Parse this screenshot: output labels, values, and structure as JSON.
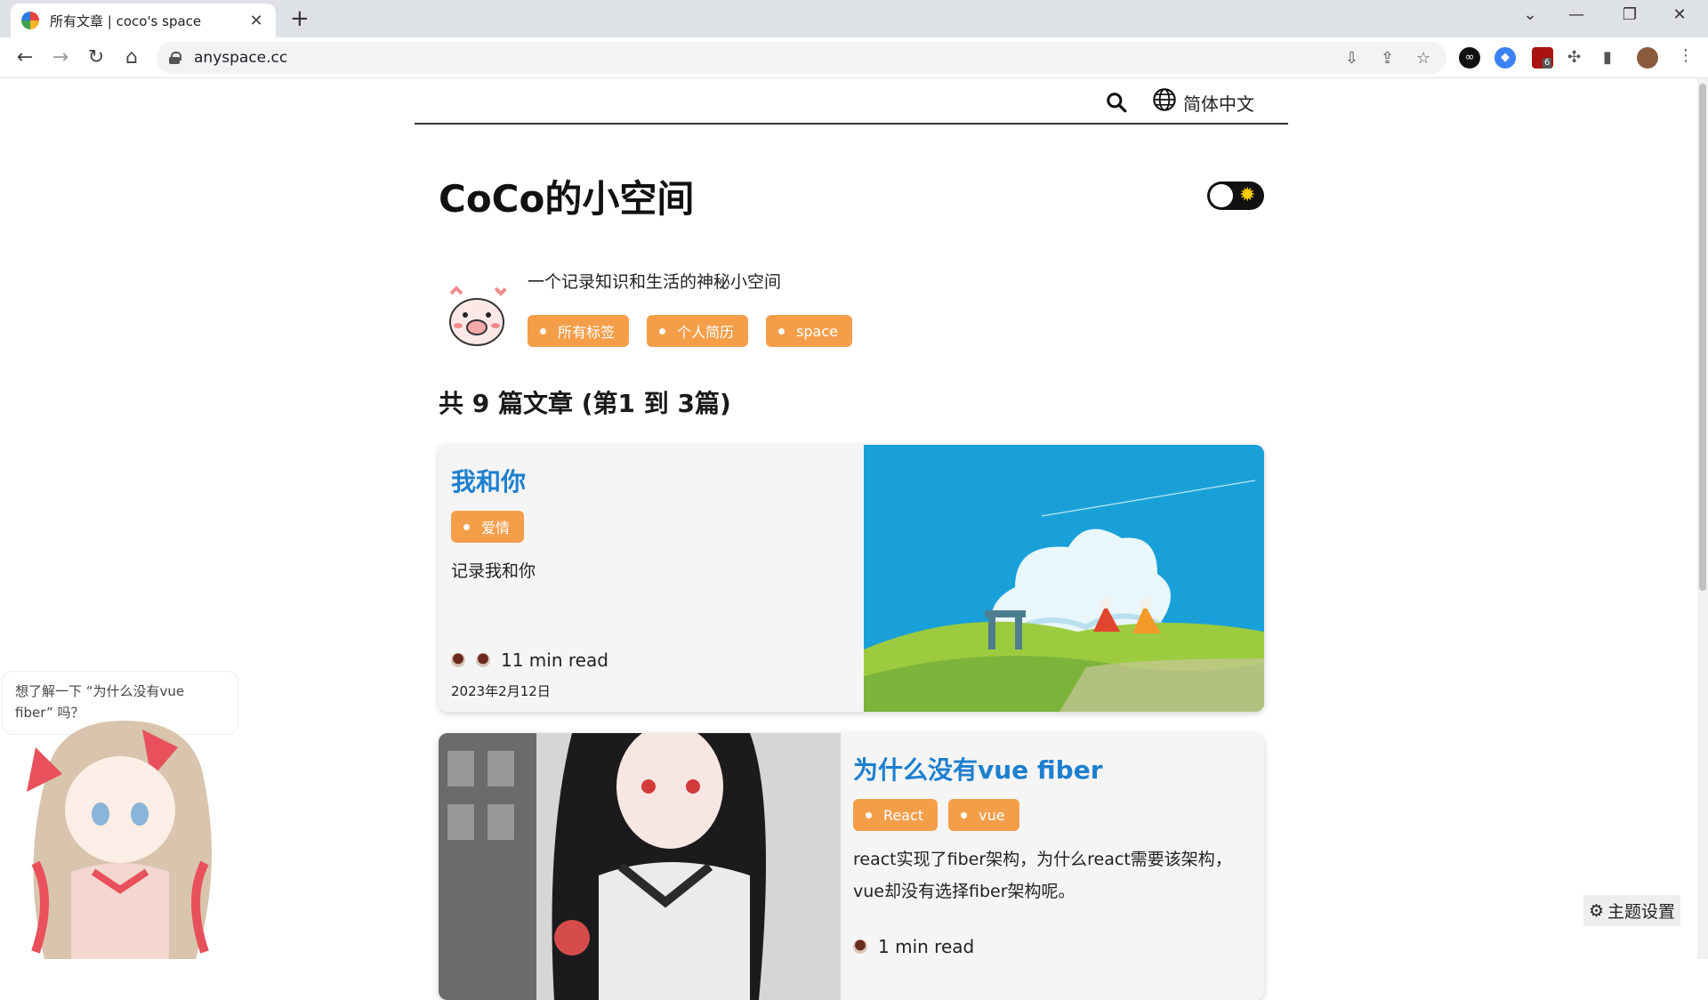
{
  "browser": {
    "tab_title": "所有文章 | coco's space",
    "url": "anyspace.cc",
    "ublock_count": "6"
  },
  "nav": {
    "language": "简体中文"
  },
  "site": {
    "title": "CoCo的小空间",
    "intro": "一个记录知识和生活的神秘小空间",
    "tags": [
      "所有标签",
      "个人简历",
      "space"
    ]
  },
  "article_count": "共 9 篇文章 (第1 到 3篇)",
  "articles": [
    {
      "title": "我和你",
      "tags": [
        "爱情"
      ],
      "description": "记录我和你",
      "read_time": "11 min read",
      "date": "2023年2月12日"
    },
    {
      "title": "为什么没有vue fiber",
      "tags": [
        "React",
        "vue"
      ],
      "description": "react实现了fiber架构，为什么react需要该架构，vue却没有选择fiber架构呢。",
      "read_time": "1 min read"
    }
  ],
  "mascot_bubble": "想了解一下 “为什么没有vue fiber” 吗？",
  "theme_settings": "主题设置",
  "colors": {
    "accent": "#f59e4a",
    "link": "#1e7fcf"
  }
}
